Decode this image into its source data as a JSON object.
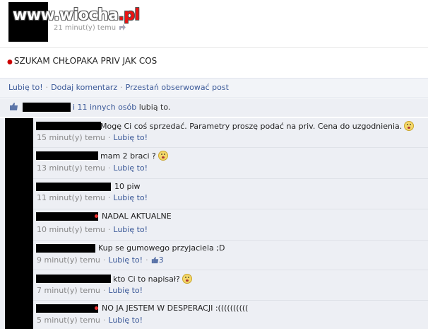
{
  "header": {
    "watermark_main": "www.wiocha",
    "watermark_suffix": ".pl",
    "time_ago": "21 minut(y) temu"
  },
  "post": {
    "text": "SZUKAM CHŁOPAKA PRIV JAK COS"
  },
  "actions": {
    "like": "Lubię to!",
    "comment": "Dodaj komentarz",
    "unfollow": "Przestań obserwować post"
  },
  "likes": {
    "others_link": "i 11 innych osób",
    "suffix": " lubią to."
  },
  "comments": [
    {
      "text": "Mogę Ci coś sprzedać. Parametry proszę podać na priv. Cena do uzgodnienia.",
      "time": "15 minut(y) temu",
      "like": "Lubię to!"
    },
    {
      "text": "mam 2 braci ?",
      "time": "13 minut(y) temu",
      "like": "Lubię to!"
    },
    {
      "text": "10 piw",
      "time": "11 minut(y) temu",
      "like": "Lubię to!"
    },
    {
      "text": "NADAL AKTUALNE",
      "time": "10 minut(y) temu",
      "like": "Lubię to!"
    },
    {
      "text": "Kup se gumowego przyjaciela ;D",
      "time": "9 minut(y) temu",
      "like": "Lubię to!",
      "like_count": "3"
    },
    {
      "text": "kto Ci to napisał?",
      "time": "7 minut(y) temu",
      "like": "Lubię to!"
    },
    {
      "text": "NO JA JESTEM W DESPERACJI :((((((((((",
      "time": "5 minut(y) temu",
      "like": "Lubię to!"
    }
  ],
  "colors": {
    "link": "#3b5998",
    "panel": "#edeff4",
    "accent_red": "#e11"
  }
}
